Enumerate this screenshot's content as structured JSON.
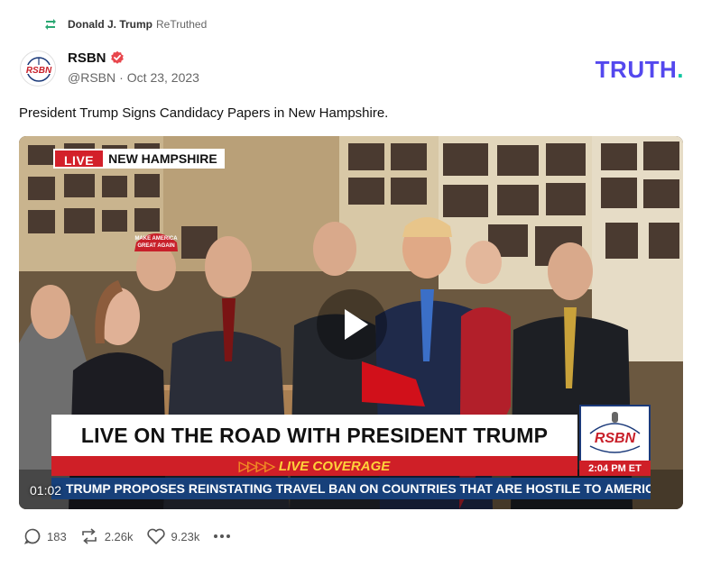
{
  "retruth": {
    "user": "Donald J. Trump",
    "label": "ReTruthed",
    "icon": "retruth-icon"
  },
  "author": {
    "name": "RSBN",
    "handle": "@RSBN",
    "separator": "·",
    "date": "Oct 23, 2023",
    "verified_icon": "verified-badge-icon",
    "avatar_text": "RSBN"
  },
  "brand": {
    "logo_main": "TRUTH",
    "logo_dot": ".",
    "colors": {
      "primary": "#5448ee",
      "dot": "#0ec5a0"
    }
  },
  "post": {
    "text": "President Trump Signs Candidacy Papers in New Hampshire."
  },
  "video": {
    "live_label": "LIVE",
    "location": "NEW HAMPSHIRE",
    "banner": "LIVE ON THE ROAD WITH PRESIDENT TRUMP",
    "subbanner": "LIVE COVERAGE",
    "subbanner_arrows": "▷▷▷▷",
    "network": "RSBN",
    "clock": "2:04 PM ET",
    "ticker": "TRUMP PROPOSES REINSTATING TRAVEL BAN ON COUNTRIES THAT ARE HOSTILE TO AMERICA:",
    "timestamp": "01:02",
    "play_icon": "play-icon",
    "hat_text_line1": "MAKE AMERICA",
    "hat_text_line2": "GREAT AGAIN"
  },
  "actions": {
    "replies": "183",
    "retruths": "2.26k",
    "likes": "9.23k"
  }
}
